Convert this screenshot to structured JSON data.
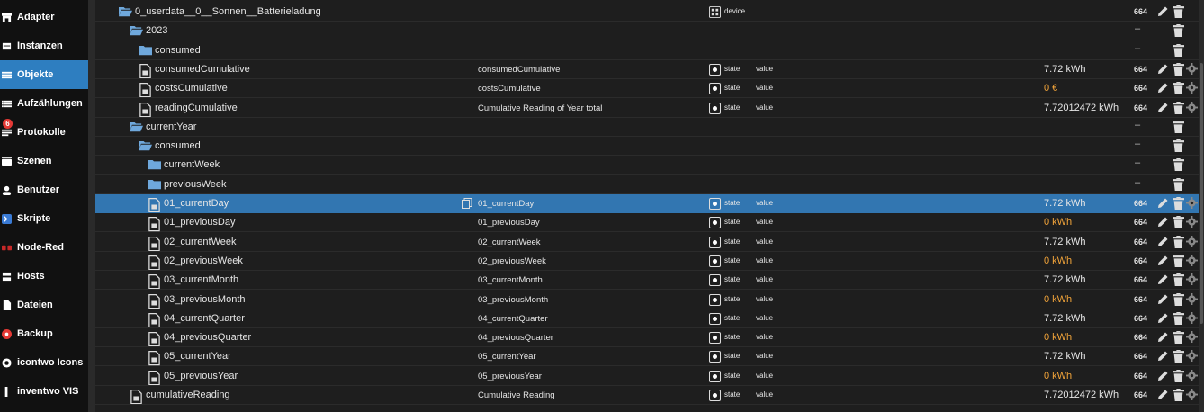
{
  "sidebar": {
    "items": [
      {
        "label": "Adapter",
        "icon": "store-icon"
      },
      {
        "label": "Instanzen",
        "icon": "instances-icon"
      },
      {
        "label": "Objekte",
        "icon": "objects-list-icon",
        "active": true
      },
      {
        "label": "Aufzählungen",
        "icon": "enums-list-icon"
      },
      {
        "label": "Protokolle",
        "icon": "logs-icon",
        "badge": "6"
      },
      {
        "label": "Szenen",
        "icon": "scenes-icon"
      },
      {
        "label": "Benutzer",
        "icon": "users-icon"
      },
      {
        "label": "Skripte",
        "icon": "scripts-icon"
      },
      {
        "label": "Node-Red",
        "icon": "node-red-icon"
      },
      {
        "label": "Hosts",
        "icon": "hosts-icon"
      },
      {
        "label": "Dateien",
        "icon": "files-icon"
      },
      {
        "label": "Backup",
        "icon": "backup-icon"
      },
      {
        "label": "icontwo Icons",
        "icon": "icontwo-icon"
      },
      {
        "label": "inventwo VIS",
        "icon": "inventwo-icon"
      }
    ]
  },
  "tree": {
    "rows": [
      {
        "name": "0_userdata__0__Sonnen__Batterieladung",
        "kind": "folder-open",
        "indent": 0,
        "type": "device",
        "acl": "664",
        "actions": [
          "edit",
          "delete"
        ]
      },
      {
        "name": "2023",
        "kind": "folder-open",
        "indent": 1,
        "acl": "–",
        "actions": [
          "delete"
        ]
      },
      {
        "name": "consumed",
        "kind": "folder",
        "indent": 2,
        "acl": "–",
        "actions": [
          "delete"
        ]
      },
      {
        "name": "consumedCumulative",
        "kind": "file",
        "indent": 2,
        "desc": "consumedCumulative",
        "type": "state",
        "role": "value",
        "value": "7.72 kWh",
        "acl": "664",
        "actions": [
          "edit",
          "delete",
          "settings"
        ]
      },
      {
        "name": "costsCumulative",
        "kind": "file",
        "indent": 2,
        "desc": "costsCumulative",
        "type": "state",
        "role": "value",
        "value": "0 €",
        "value_color": "orange",
        "acl": "664",
        "actions": [
          "edit",
          "delete",
          "settings"
        ]
      },
      {
        "name": "readingCumulative",
        "kind": "file",
        "indent": 2,
        "desc": "Cumulative Reading of Year total",
        "type": "state",
        "role": "value",
        "value": "7.72012472 kWh",
        "acl": "664",
        "actions": [
          "edit",
          "delete",
          "settings"
        ]
      },
      {
        "name": "currentYear",
        "kind": "folder-open",
        "indent": 1,
        "acl": "–",
        "actions": [
          "delete"
        ]
      },
      {
        "name": "consumed",
        "kind": "folder-open",
        "indent": 2,
        "acl": "–",
        "actions": [
          "delete"
        ]
      },
      {
        "name": "currentWeek",
        "kind": "folder",
        "indent": 3,
        "acl": "–",
        "actions": [
          "delete"
        ]
      },
      {
        "name": "previousWeek",
        "kind": "folder",
        "indent": 3,
        "acl": "–",
        "actions": [
          "delete"
        ]
      },
      {
        "name": "01_currentDay",
        "kind": "file",
        "indent": 3,
        "desc": "01_currentDay",
        "type": "state",
        "role": "value",
        "value": "7.72 kWh",
        "acl": "664",
        "selected": true,
        "actions": [
          "edit",
          "delete",
          "settings"
        ]
      },
      {
        "name": "01_previousDay",
        "kind": "file",
        "indent": 3,
        "desc": "01_previousDay",
        "type": "state",
        "role": "value",
        "value": "0 kWh",
        "value_color": "orange",
        "acl": "664",
        "actions": [
          "edit",
          "delete",
          "settings"
        ]
      },
      {
        "name": "02_currentWeek",
        "kind": "file",
        "indent": 3,
        "desc": "02_currentWeek",
        "type": "state",
        "role": "value",
        "value": "7.72 kWh",
        "acl": "664",
        "actions": [
          "edit",
          "delete",
          "settings"
        ]
      },
      {
        "name": "02_previousWeek",
        "kind": "file",
        "indent": 3,
        "desc": "02_previousWeek",
        "type": "state",
        "role": "value",
        "value": "0 kWh",
        "value_color": "orange",
        "acl": "664",
        "actions": [
          "edit",
          "delete",
          "settings"
        ]
      },
      {
        "name": "03_currentMonth",
        "kind": "file",
        "indent": 3,
        "desc": "03_currentMonth",
        "type": "state",
        "role": "value",
        "value": "7.72 kWh",
        "acl": "664",
        "actions": [
          "edit",
          "delete",
          "settings"
        ]
      },
      {
        "name": "03_previousMonth",
        "kind": "file",
        "indent": 3,
        "desc": "03_previousMonth",
        "type": "state",
        "role": "value",
        "value": "0 kWh",
        "value_color": "orange",
        "acl": "664",
        "actions": [
          "edit",
          "delete",
          "settings"
        ]
      },
      {
        "name": "04_currentQuarter",
        "kind": "file",
        "indent": 3,
        "desc": "04_currentQuarter",
        "type": "state",
        "role": "value",
        "value": "7.72 kWh",
        "acl": "664",
        "actions": [
          "edit",
          "delete",
          "settings"
        ]
      },
      {
        "name": "04_previousQuarter",
        "kind": "file",
        "indent": 3,
        "desc": "04_previousQuarter",
        "type": "state",
        "role": "value",
        "value": "0 kWh",
        "value_color": "orange",
        "acl": "664",
        "actions": [
          "edit",
          "delete",
          "settings"
        ]
      },
      {
        "name": "05_currentYear",
        "kind": "file",
        "indent": 3,
        "desc": "05_currentYear",
        "type": "state",
        "role": "value",
        "value": "7.72 kWh",
        "acl": "664",
        "actions": [
          "edit",
          "delete",
          "settings"
        ]
      },
      {
        "name": "05_previousYear",
        "kind": "file",
        "indent": 3,
        "desc": "05_previousYear",
        "type": "state",
        "role": "value",
        "value": "0 kWh",
        "value_color": "orange",
        "acl": "664",
        "actions": [
          "edit",
          "delete",
          "settings"
        ]
      },
      {
        "name": "cumulativeReading",
        "kind": "file",
        "indent": 1,
        "desc": "Cumulative Reading",
        "type": "state",
        "role": "value",
        "value": "7.72012472 kWh",
        "acl": "664",
        "actions": [
          "edit",
          "delete",
          "settings"
        ]
      }
    ]
  },
  "colors": {
    "selected": "#3276b1",
    "orange_value": "#f2a43a",
    "folder": "#6fa8dc"
  }
}
